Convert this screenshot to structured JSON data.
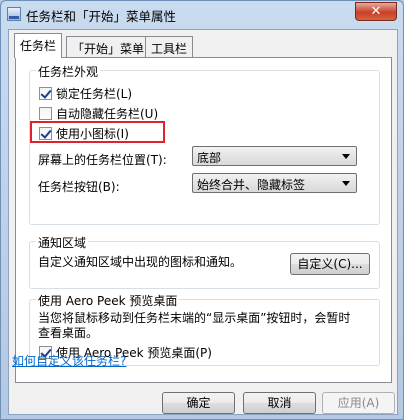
{
  "window": {
    "title": "任务栏和「开始」菜单属性",
    "close_glyph": "✕"
  },
  "tabs": [
    {
      "label": "任务栏",
      "active": true
    },
    {
      "label": "「开始」菜单",
      "active": false
    },
    {
      "label": "工具栏",
      "active": false
    }
  ],
  "appearance": {
    "legend": "任务栏外观",
    "lock_taskbar": {
      "label": "锁定任务栏(L)",
      "checked": true
    },
    "auto_hide": {
      "label": "自动隐藏任务栏(U)",
      "checked": false
    },
    "small_icons": {
      "label": "使用小图标(I)",
      "checked": true
    },
    "location_label": "屏幕上的任务栏位置(T):",
    "location_value": "底部",
    "buttons_label": "任务栏按钮(B):",
    "buttons_value": "始终合并、隐藏标签"
  },
  "notification": {
    "legend": "通知区域",
    "description": "自定义通知区域中出现的图标和通知。",
    "customize_button": "自定义(C)..."
  },
  "aero_peek": {
    "legend": "使用 Aero Peek 预览桌面",
    "description_line1": "当您将鼠标移动到任务栏末端的“显示桌面”按钮时，会暂时",
    "description_line2": "查看桌面。",
    "checkbox": {
      "label": "使用 Aero Peek 预览桌面(P)",
      "checked": true
    }
  },
  "help_link": "如何自定义该任务栏?",
  "footer": {
    "ok": "确定",
    "cancel": "取消",
    "apply": "应用(A)"
  },
  "colors": {
    "accent_link": "#0066cc",
    "highlight": "#e0232a"
  }
}
